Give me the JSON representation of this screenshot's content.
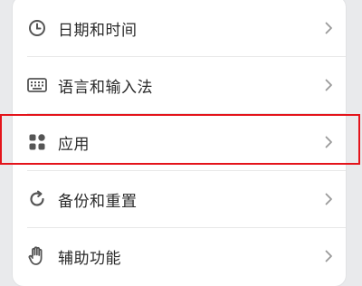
{
  "settings": {
    "items": [
      {
        "label": "日期和时间",
        "icon": "clock-icon"
      },
      {
        "label": "语言和输入法",
        "icon": "keyboard-icon"
      },
      {
        "label": "应用",
        "icon": "apps-grid-icon"
      },
      {
        "label": "备份和重置",
        "icon": "refresh-icon"
      },
      {
        "label": "辅助功能",
        "icon": "hand-icon"
      }
    ]
  },
  "colors": {
    "highlight": "#e4141b",
    "panel": "#ffffff",
    "background": "#e9eaec"
  }
}
